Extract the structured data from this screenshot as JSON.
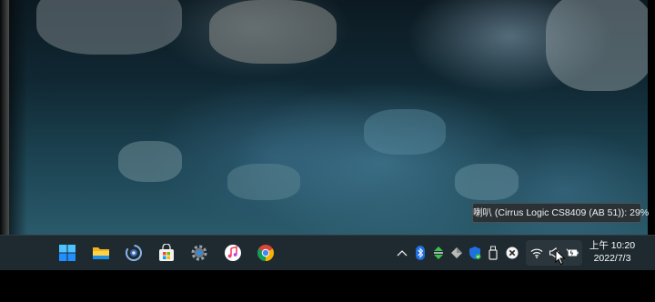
{
  "tooltip": {
    "text": "喇叭 (Cirrus Logic CS8409 (AB 51)): 29%"
  },
  "clock": {
    "time": "上午 10:20",
    "date": "2022/7/3"
  },
  "taskbar": {
    "apps": [
      {
        "name": "start",
        "icon": "windows-logo-icon"
      },
      {
        "name": "file-explorer",
        "icon": "folder-icon"
      },
      {
        "name": "app-circle",
        "icon": "circular-app-icon"
      },
      {
        "name": "microsoft-store",
        "icon": "store-bag-icon"
      },
      {
        "name": "settings",
        "icon": "gear-icon"
      },
      {
        "name": "itunes",
        "icon": "music-note-icon"
      },
      {
        "name": "chrome",
        "icon": "chrome-icon"
      }
    ],
    "tray": [
      {
        "name": "show-hidden-icons",
        "icon": "chevron-up-icon"
      },
      {
        "name": "bluetooth",
        "icon": "bluetooth-icon"
      },
      {
        "name": "network-arrows",
        "icon": "up-down-arrows-icon"
      },
      {
        "name": "tray-app-diamond",
        "icon": "diamond-icon"
      },
      {
        "name": "security",
        "icon": "shield-icon"
      },
      {
        "name": "usb-drive",
        "icon": "usb-drive-icon"
      },
      {
        "name": "tray-app-x",
        "icon": "close-circle-icon"
      },
      {
        "name": "wifi",
        "icon": "wifi-icon"
      },
      {
        "name": "volume",
        "icon": "speaker-icon"
      },
      {
        "name": "battery",
        "icon": "battery-icon"
      }
    ]
  },
  "colors": {
    "taskbar_bg": "#1f2a30",
    "tooltip_bg": "#2b3236",
    "accent_blue": "#1e90ff"
  }
}
